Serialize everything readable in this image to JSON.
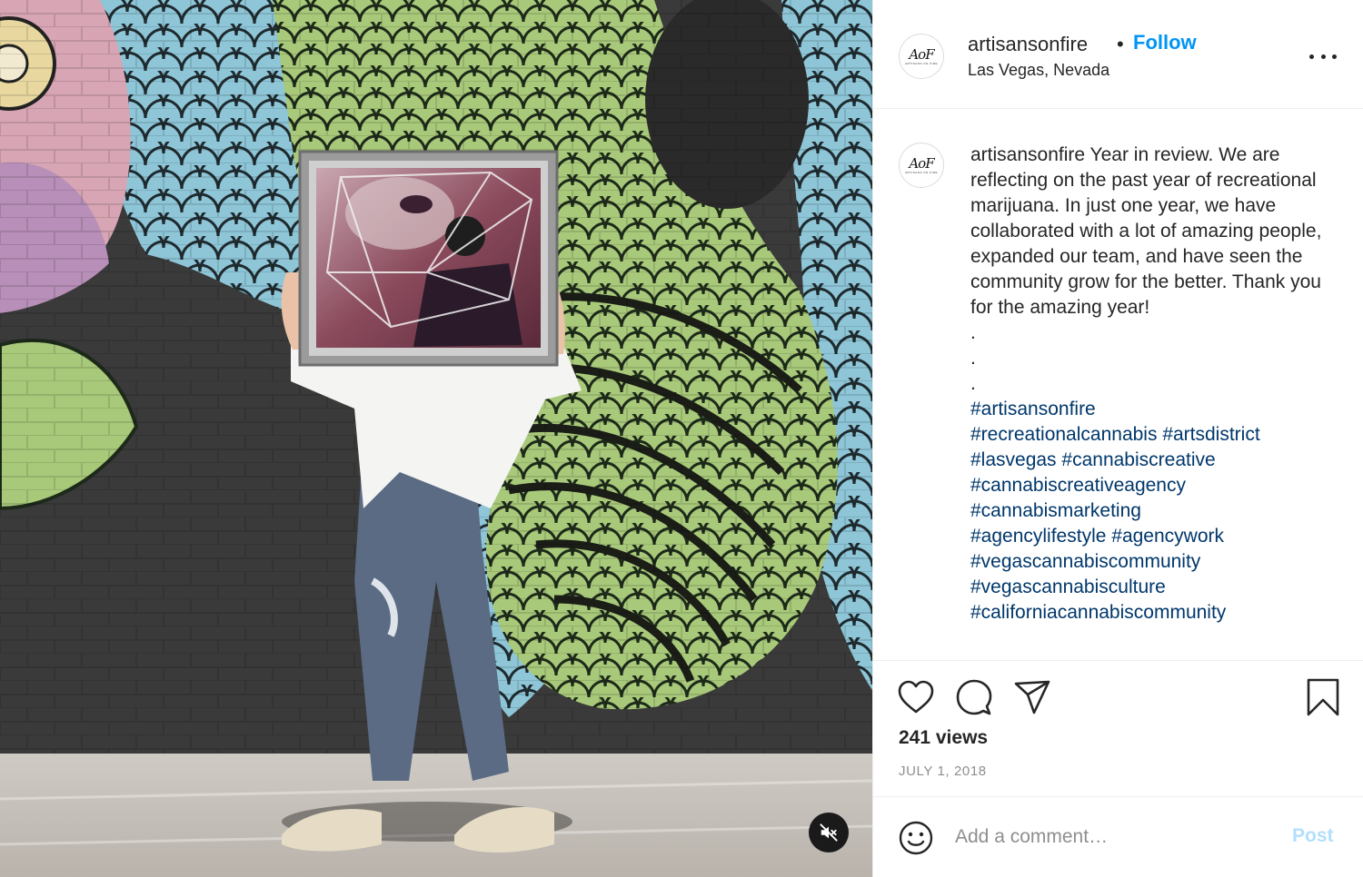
{
  "post": {
    "username": "artisansonfire",
    "separator": "•",
    "follow_label": "Follow",
    "location": "Las Vegas, Nevada",
    "avatar": {
      "logo_text": "AoF",
      "logo_subtext": "ARTISANS ON FIRE"
    },
    "caption": {
      "username": "artisansonfire",
      "text": "Year in review. We are reflecting on the past year of recreational marijuana. In just one year, we have collaborated with a lot of amazing people, expanded our team, and have seen the community grow for the better. Thank you for the amazing year!",
      "dots": [
        ".",
        ".",
        "."
      ],
      "hashtags": [
        "#artisansonfire",
        "#recreationalcannabis",
        "#artsdistrict",
        "#lasvegas",
        "#cannabiscreative",
        "#cannabiscreativeagency",
        "#cannabismarketing",
        "#agencylifestyle",
        "#agencywork",
        "#vegascannabiscommunity",
        "#vegascannabisculture",
        "#californiacannabiscommunity"
      ]
    },
    "views": "241 views",
    "date": "JULY 1, 2018",
    "comment_placeholder": "Add a comment…",
    "post_label": "Post"
  },
  "icons": {
    "like": "heart-icon",
    "comment": "comment-bubble-icon",
    "share": "paper-plane-icon",
    "save": "bookmark-icon",
    "more": "more-options-icon",
    "emoji": "smiley-icon",
    "mute": "speaker-muted-icon"
  },
  "colors": {
    "follow": "#0095f6",
    "hashtag": "#00376b",
    "post_disabled": "#b2dffc",
    "muted_text": "#8e8e8e"
  }
}
